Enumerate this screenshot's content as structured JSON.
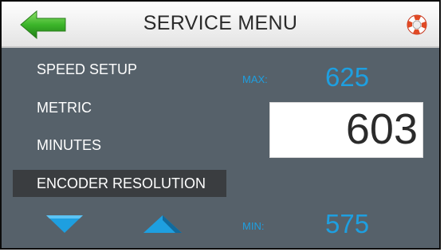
{
  "window": {
    "title": "SERVICE MENU",
    "back_icon": "back-arrow-icon",
    "help_icon": "lifebuoy-icon"
  },
  "menu": {
    "items": [
      {
        "label": "SPEED SETUP",
        "selected": false
      },
      {
        "label": "METRIC",
        "selected": false
      },
      {
        "label": "MINUTES",
        "selected": false
      },
      {
        "label": "ENCODER RESOLUTION",
        "selected": true
      }
    ]
  },
  "controls": {
    "down_icon": "down-triangle-icon",
    "up_icon": "up-triangle-icon"
  },
  "setting": {
    "max_label": "MAX:",
    "max_value": "625",
    "current_value": "603",
    "min_label": "MIN:",
    "min_value": "575"
  },
  "colors": {
    "panel": "#56616a",
    "accent_blue": "#1e9fe0",
    "back_arrow_green": "#3cb52a",
    "selected_row": "#3a3d40"
  }
}
